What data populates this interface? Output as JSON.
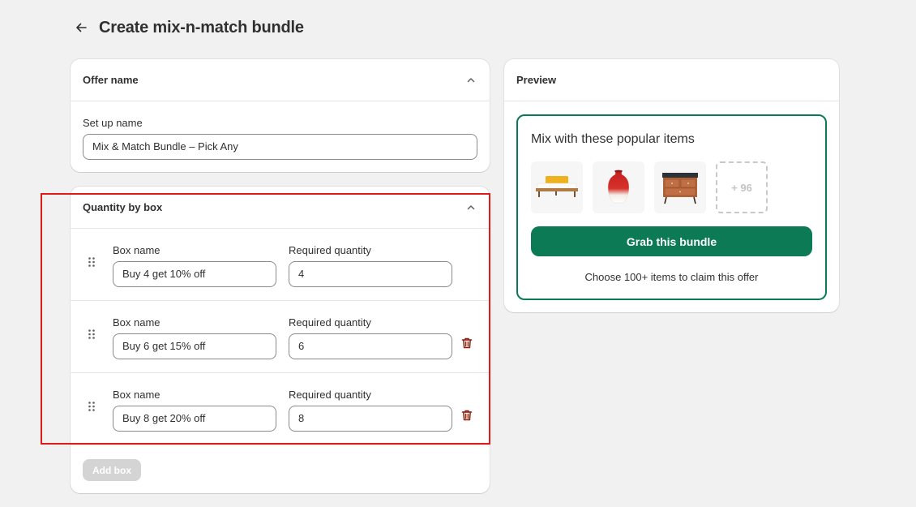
{
  "page": {
    "title": "Create mix-n-match bundle"
  },
  "offer_card": {
    "title": "Offer name",
    "field_label": "Set up name",
    "field_value": "Mix & Match Bundle – Pick Any"
  },
  "quantity_card": {
    "title": "Quantity by box",
    "boxes": [
      {
        "name_label": "Box name",
        "name_value": "Buy 4 get 10% off",
        "qty_label": "Required quantity",
        "qty_value": "4",
        "deletable": false
      },
      {
        "name_label": "Box name",
        "name_value": "Buy 6 get 15% off",
        "qty_label": "Required quantity",
        "qty_value": "6",
        "deletable": true
      },
      {
        "name_label": "Box name",
        "name_value": "Buy 8 get 20% off",
        "qty_label": "Required quantity",
        "qty_value": "8",
        "deletable": true
      }
    ],
    "add_box_label": "Add box"
  },
  "preview_card": {
    "title": "Preview",
    "heading": "Mix with these popular items",
    "thumbnails": [
      "bed-image",
      "vase-image",
      "dresser-image"
    ],
    "more_count_label": "+ 96",
    "button_label": "Grab this bundle",
    "note": "Choose 100+ items to claim this offer"
  },
  "colors": {
    "primary": "#0b7a55",
    "highlight": "#e01919",
    "delete": "#8e1f0b",
    "background": "#f1f1f1"
  }
}
